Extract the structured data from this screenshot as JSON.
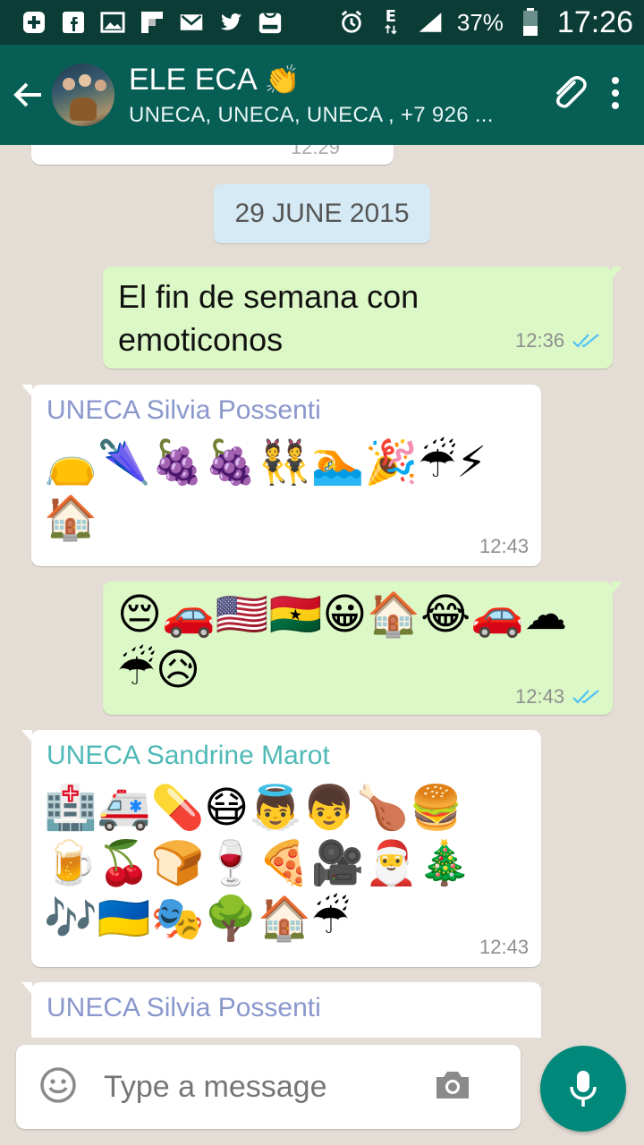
{
  "status_bar": {
    "battery": "37%",
    "time": "17:26",
    "network": "E",
    "icons": [
      "add-icon",
      "facebook-icon",
      "image-icon",
      "flipboard-icon",
      "gmail-icon",
      "twitter-icon",
      "galaxy-store-icon",
      "alarm-icon",
      "signal-icon",
      "battery-icon"
    ]
  },
  "header": {
    "title": "ELE ECA",
    "title_emoji": "👏",
    "subtitle": "UNECA, UNECA, UNECA , +7 926 ..."
  },
  "chat": {
    "partial_top_time": "12:29",
    "date_label": "29 JUNE 2015",
    "messages": [
      {
        "direction": "out",
        "text": "El fin de semana con emoticonos",
        "time": "12:36"
      },
      {
        "direction": "in",
        "sender": "UNECA Silvia Possenti",
        "sender_color": "#8a97cc",
        "emoji": "👝🌂🍇🍇👯🏊🎉☔⚡🏠",
        "time": "12:43"
      },
      {
        "direction": "out",
        "emoji": "😔🚗🇺🇸🇬🇭😀🏠😂🚗☁☔😥",
        "time": "12:43"
      },
      {
        "direction": "in",
        "sender": "UNECA Sandrine Marot",
        "sender_color": "#4fb9b6",
        "emoji": "🏥🚑💊😷👼👦🍗🍔🍺🍒🍞🍷🍕🎥🎅🎄🎶🇺🇦🎭🌳🏠☔",
        "time": "12:43"
      },
      {
        "direction": "in",
        "sender": "UNECA Silvia Possenti",
        "sender_color": "#8a97cc"
      }
    ]
  },
  "composer": {
    "placeholder": "Type a message"
  },
  "colors": {
    "header": "#075e54",
    "status_bar": "#0b3d36",
    "outgoing": "#dcf8c6",
    "incoming": "#ffffff",
    "read_ticks": "#4fc3f7",
    "mic": "#00897b"
  }
}
